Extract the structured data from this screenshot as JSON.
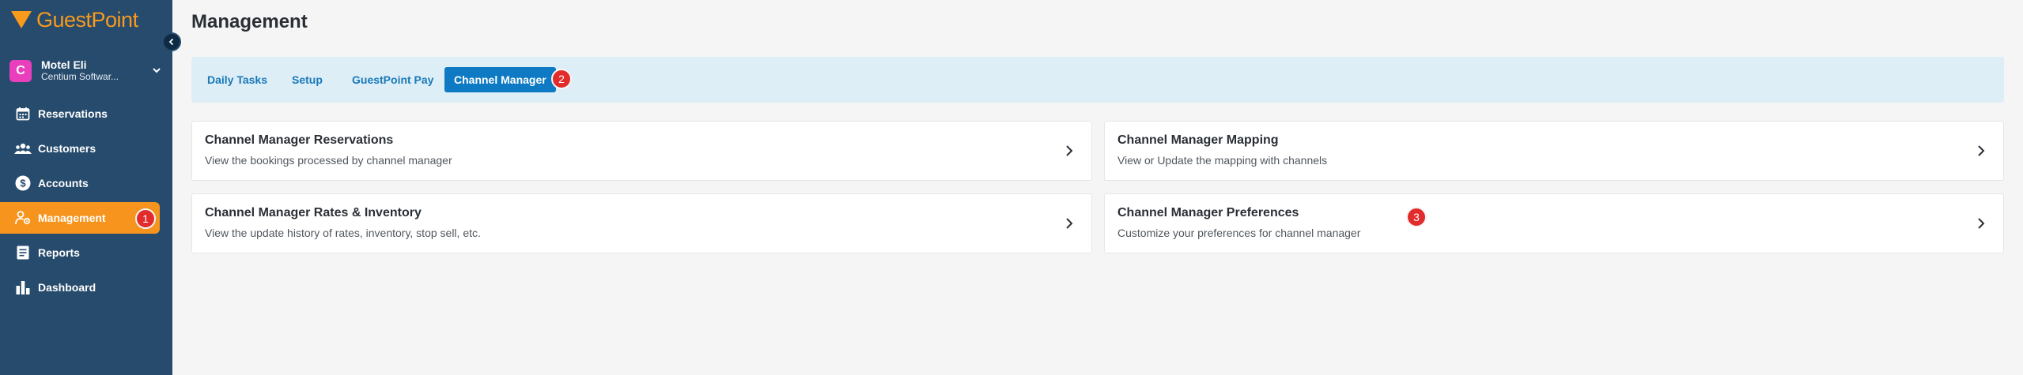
{
  "brand": {
    "name": "GuestPoint",
    "color": "#f89a1c"
  },
  "property": {
    "initial": "C",
    "name": "Motel Eli",
    "company": "Centium Softwar..."
  },
  "sidebar": {
    "items": [
      {
        "label": "Reservations",
        "icon": "calendar-icon"
      },
      {
        "label": "Customers",
        "icon": "users-icon"
      },
      {
        "label": "Accounts",
        "icon": "dollar-circle-icon"
      },
      {
        "label": "Management",
        "icon": "user-gear-icon",
        "active": true
      },
      {
        "label": "Reports",
        "icon": "report-icon"
      },
      {
        "label": "Dashboard",
        "icon": "bar-chart-icon"
      }
    ]
  },
  "page": {
    "title": "Management"
  },
  "tabs": [
    {
      "label": "Daily Tasks"
    },
    {
      "label": "Setup"
    },
    {
      "label": "GuestPoint Pay"
    },
    {
      "label": "Channel Manager",
      "active": true
    }
  ],
  "cards": [
    {
      "title": "Channel Manager Reservations",
      "description": "View the bookings processed by channel manager"
    },
    {
      "title": "Channel Manager Mapping",
      "description": "View or Update the mapping with channels"
    },
    {
      "title": "Channel Manager Rates & Inventory",
      "description": "View the update history of rates, inventory, stop sell, etc."
    },
    {
      "title": "Channel Manager Preferences",
      "description": "Customize your preferences for channel manager"
    }
  ],
  "steps": [
    "1",
    "2",
    "3"
  ],
  "colors": {
    "sidebar": "#274b6d",
    "accent": "#f7941d",
    "tab_active": "#0e7ac3",
    "step_badge": "#e22b2b"
  }
}
